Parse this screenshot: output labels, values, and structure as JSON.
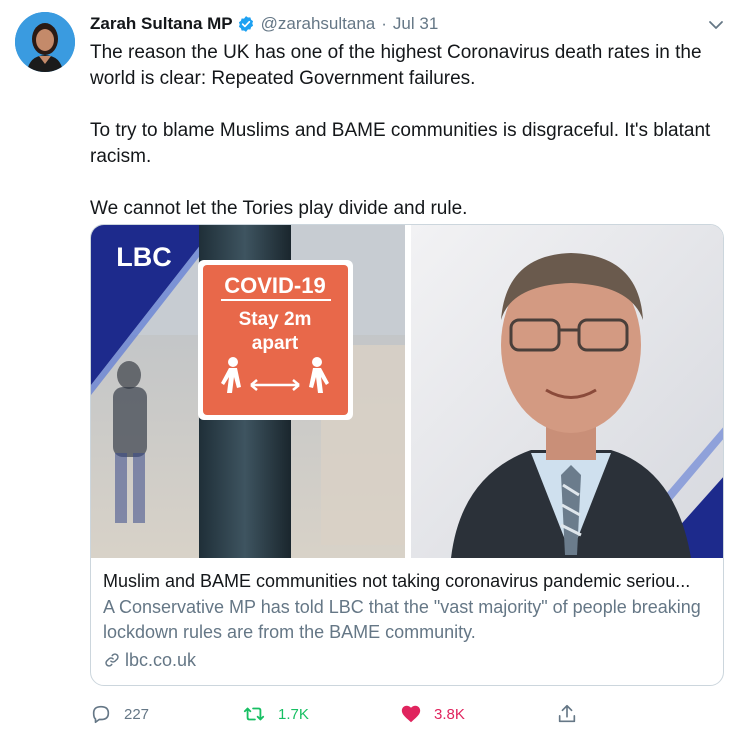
{
  "tweet": {
    "author_name": "Zarah Sultana MP",
    "handle": "@zarahsultana",
    "separator": "·",
    "date": "Jul 31",
    "paragraphs": [
      "The reason the UK has one of the highest Coronavirus death rates in the world is clear: Repeated Government failures.",
      "To try to blame Muslims and BAME communities is disgraceful. It's blatant racism.",
      "We cannot let the Tories play divide and rule."
    ]
  },
  "card": {
    "logo": "LBC",
    "sign": {
      "line1": "COVID-19",
      "line2": "Stay 2m",
      "line3": "apart"
    },
    "title": "Muslim and BAME communities not taking coronavirus pandemic seriou...",
    "description": "A Conservative MP has told LBC that the \"vast majority\" of people breaking lockdown rules are from the BAME community.",
    "domain": "lbc.co.uk"
  },
  "actions": {
    "reply_count": "227",
    "retweet_count": "1.7K",
    "like_count": "3.8K"
  },
  "colors": {
    "verified": "#1da1f2",
    "retweet": "#17bf63",
    "like": "#e0245e",
    "muted": "#657786",
    "lbc_blue": "#1d2a8c",
    "sign_orange": "#e8684a"
  },
  "icons": [
    "verified-badge-icon",
    "chevron-down-icon",
    "link-icon",
    "reply-icon",
    "retweet-icon",
    "like-icon",
    "share-icon"
  ]
}
